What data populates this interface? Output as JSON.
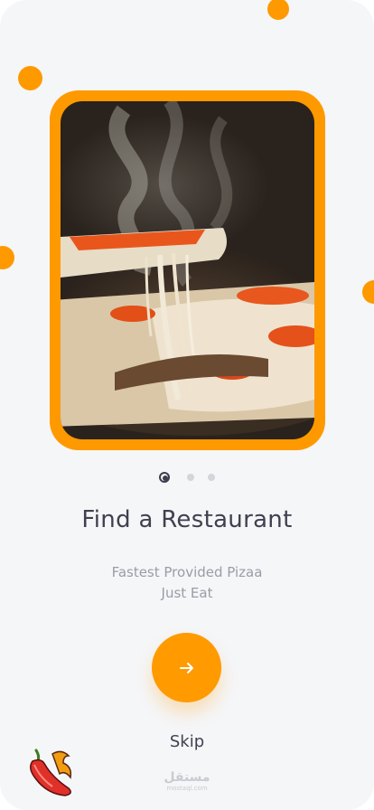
{
  "onboarding": {
    "title": "Find a Restaurant",
    "subtitle_line1": "Fastest Provided Pizaa",
    "subtitle_line2": "Just Eat",
    "skip_label": "Skip",
    "page_count": 3,
    "active_page": 1,
    "hero_image": "pizza-slice-photo"
  },
  "colors": {
    "accent": "#ff9900",
    "title": "#3f4150",
    "subtitle": "#9a9ca6",
    "background": "#f5f6f8"
  },
  "icons": {
    "next": "arrow-right-icon",
    "brand": "chili-pepper-logo"
  },
  "watermark": {
    "arabic": "مستقل",
    "latin": "mostaql.com"
  }
}
